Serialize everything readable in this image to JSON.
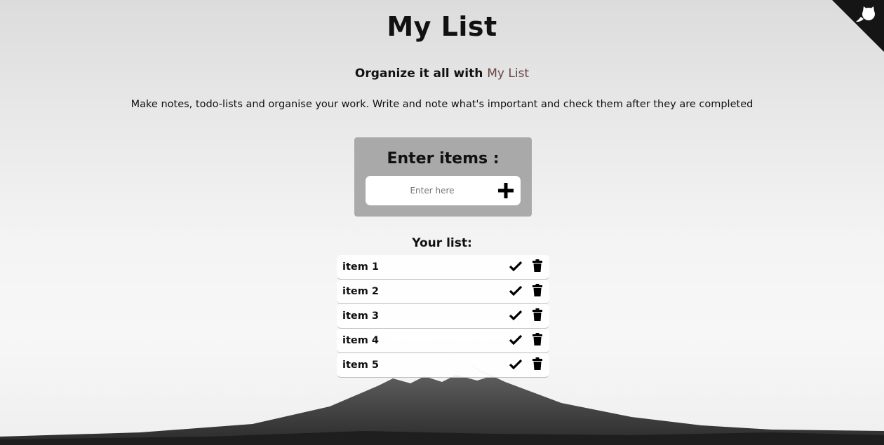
{
  "header": {
    "title": "My List",
    "tagline_prefix": "Organize it all with ",
    "tagline_brand": "My List",
    "description": "Make notes, todo-lists and organise your work. Write and note what's important and check them after they are completed"
  },
  "entry": {
    "heading": "Enter items :",
    "input_placeholder": "Enter here",
    "input_value": "",
    "add_icon": "plus-icon"
  },
  "list": {
    "heading": "Your list:",
    "items": [
      {
        "label": "item 1"
      },
      {
        "label": "item 2"
      },
      {
        "label": "item 3"
      },
      {
        "label": "item 4"
      },
      {
        "label": "item 5"
      }
    ],
    "item_actions": [
      "check-icon",
      "trash-icon"
    ]
  },
  "corner": {
    "icon": "github-octocat-icon"
  },
  "colors": {
    "brand_text": "#6b4546",
    "card_bg": "#969696",
    "corner_bg": "#151515"
  }
}
